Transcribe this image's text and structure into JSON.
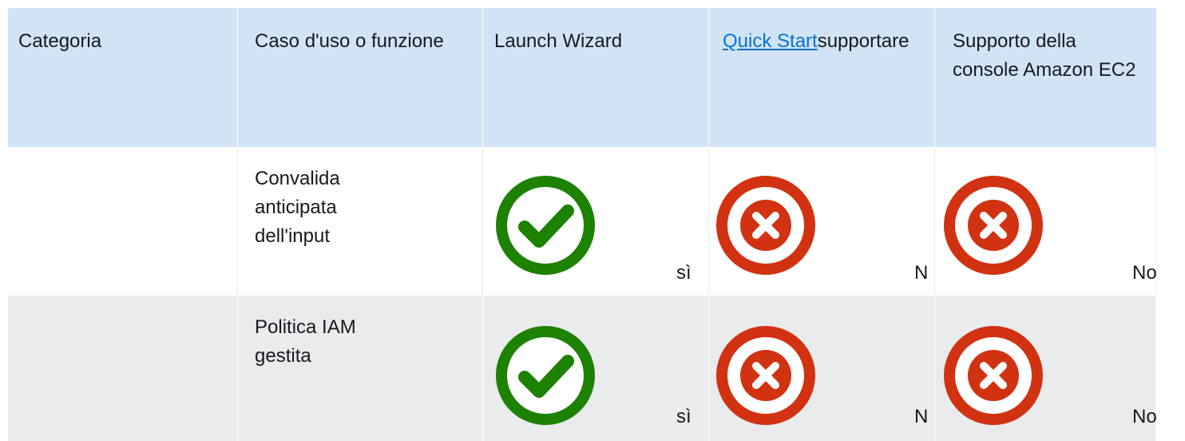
{
  "header": {
    "col1": "Categoria",
    "col2": "Caso d'uso o funzione",
    "col3": "Launch Wizard",
    "col4_link": "Quick Start",
    "col4_suffix": "supportare",
    "col5": "Supporto della console Amazon EC2"
  },
  "rows": [
    {
      "category": "",
      "feature": "Convalida anticipata dell'input",
      "launch_wizard": {
        "icon": "check-circle-icon",
        "text": "sì"
      },
      "quick_start": {
        "icon": "x-circle-icon",
        "text": "N"
      },
      "ec2_console": {
        "icon": "x-circle-icon",
        "text": "No"
      }
    },
    {
      "category": "",
      "feature": "Politica IAM gestita",
      "launch_wizard": {
        "icon": "check-circle-icon",
        "text": "sì"
      },
      "quick_start": {
        "icon": "x-circle-icon",
        "text": "N"
      },
      "ec2_console": {
        "icon": "x-circle-icon",
        "text": "No"
      }
    }
  ],
  "colors": {
    "header_bg": "#d1e4f6",
    "row_alt_bg": "#e9ebed",
    "link": "#0972d3",
    "check_green": "#1d8102",
    "x_red": "#d13212"
  }
}
